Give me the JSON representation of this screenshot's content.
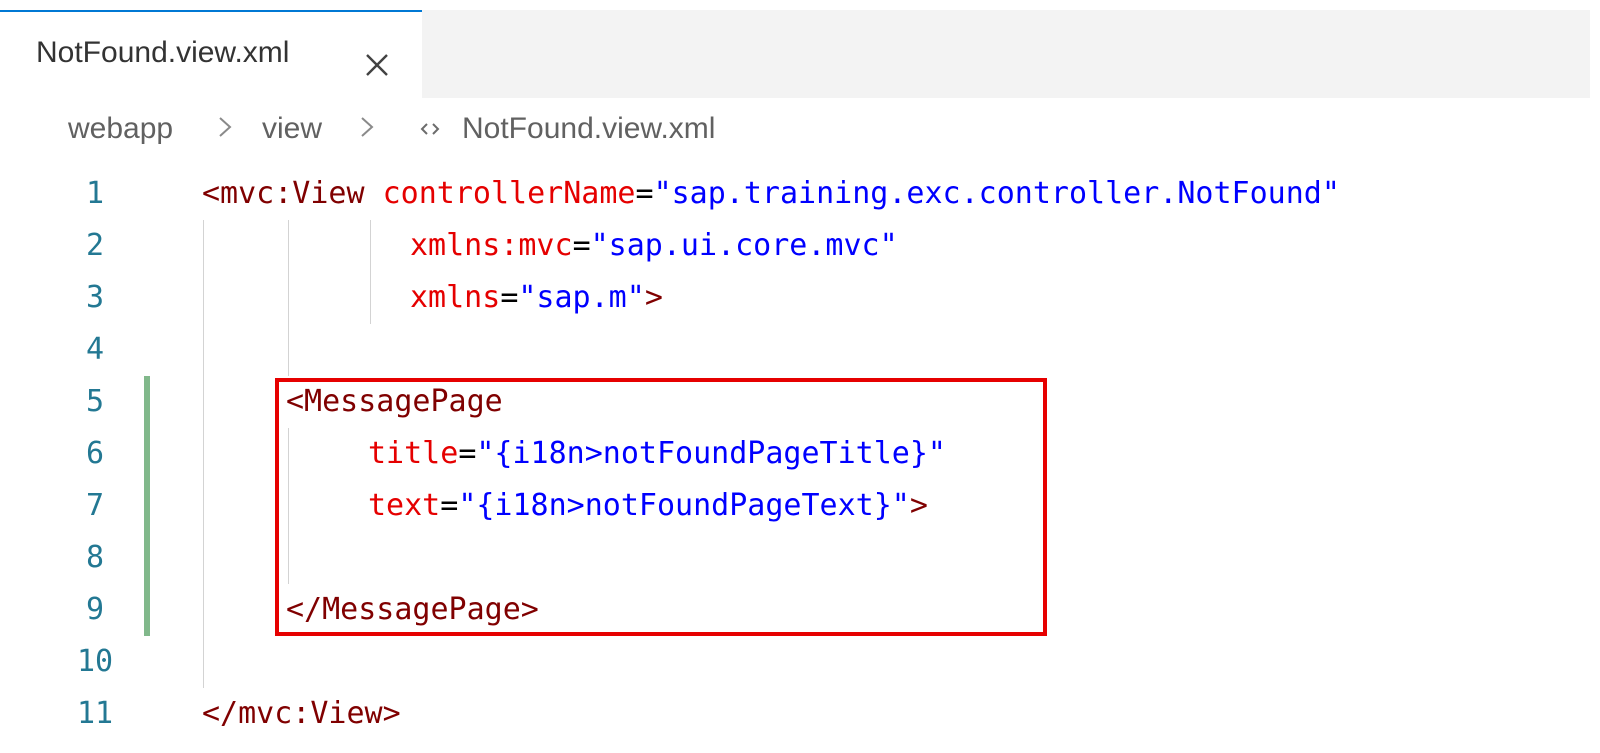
{
  "tab": {
    "title": "NotFound.view.xml",
    "close_icon": "close-icon",
    "accent": "#0078d4"
  },
  "breadcrumb": {
    "items": [
      "webapp",
      "view",
      "NotFound.view.xml"
    ],
    "separator_icon": "chevron-right-icon",
    "file_icon": "xml-file-icon"
  },
  "editor": {
    "line_numbers": [
      "1",
      "2",
      "3",
      "4",
      "5",
      "6",
      "7",
      "8",
      "9",
      "10",
      "11"
    ],
    "lines": [
      {
        "t1": "<mvc:View",
        "a1": "controllerName",
        "eq": "=",
        "v1": "\"sap.training.exc.controller.NotFound\""
      },
      {
        "a1": "xmlns:mvc",
        "eq": "=",
        "v1": "\"sap.ui.core.mvc\""
      },
      {
        "a1": "xmlns",
        "eq": "=",
        "v1": "\"sap.m\"",
        "close": ">"
      },
      {},
      {
        "t1": "<MessagePage"
      },
      {
        "a1": "title",
        "eq": "=",
        "v1": "\"{i18n>notFoundPageTitle}\""
      },
      {
        "a1": "text",
        "eq": "=",
        "v1": "\"{i18n>notFoundPageText}\"",
        "close": ">"
      },
      {},
      {
        "t1": "</MessagePage>"
      },
      {},
      {
        "t1": "</mvc:View>"
      }
    ],
    "colors": {
      "tag": "#800000",
      "attribute": "#e50000",
      "value": "#0000ff",
      "line_number": "#237893",
      "modified_gutter": "#81b88b",
      "highlight_box": "#e60000"
    }
  }
}
